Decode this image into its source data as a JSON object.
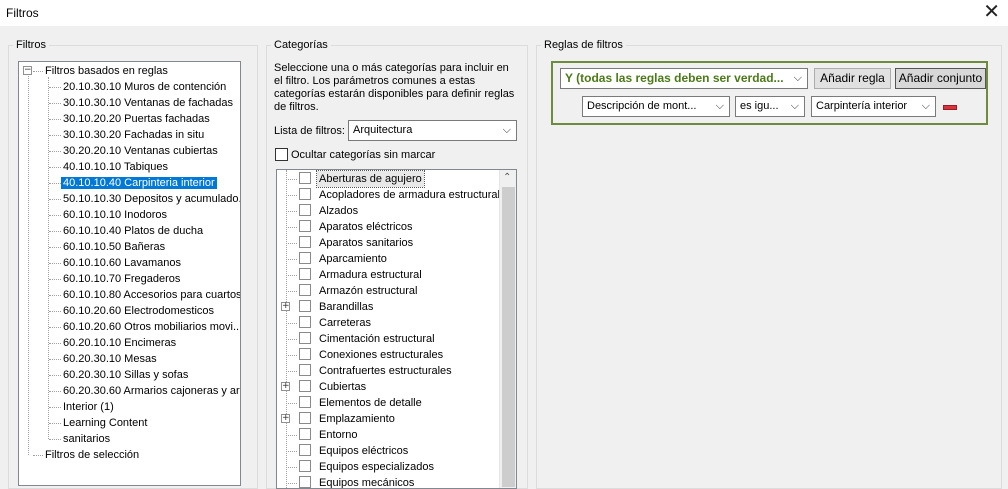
{
  "window": {
    "title": "Filtros",
    "close_glyph": "✕"
  },
  "filters_panel": {
    "legend": "Filtros",
    "root_label": "Filtros basados en reglas",
    "selected_item": "40.10.10.40 Carpinteria interior",
    "items": [
      "20.10.30.10 Muros de contención",
      "30.10.30.10 Ventanas de fachadas",
      "30.10.20.20 Puertas fachadas",
      "30.10.30.20 Fachadas in situ",
      "30.20.20.10 Ventanas cubiertas",
      "40.10.10.10 Tabiques",
      "40.10.10.40 Carpinteria interior",
      "50.10.10.30 Depositos y acumulado...",
      "60.10.10.10 Inodoros",
      "60.10.10.40 Platos de ducha",
      "60.10.10.50 Bañeras",
      "60.10.10.60 Lavamanos",
      "60.10.10.70 Fregaderos",
      "60.10.10.80 Accesorios para cuartos",
      "60.10.20.60 Electrodomesticos",
      "60.10.20.60 Otros mobiliarios movi...",
      "60.20.10.10 Encimeras",
      "60.20.30.10 Mesas",
      "60.20.30.10 Sillas y sofas",
      "60.20.30.60 Armarios cajoneras y arc",
      "Interior (1)",
      "Learning Content",
      "sanitarios"
    ],
    "selection_root_label": "Filtros de selección"
  },
  "categories_panel": {
    "legend": "Categorías",
    "description": "Seleccione una o más categorías para incluir en el filtro. Los parámetros comunes a estas categorías estarán disponibles para definir reglas de filtros.",
    "filter_list_label": "Lista de filtros:",
    "filter_list_value": "Arquitectura",
    "hide_unchecked_label": "Ocultar categorías sin marcar",
    "items": [
      {
        "label": "Aberturas de agujero",
        "expandable": false
      },
      {
        "label": "Acopladores de armadura estructural",
        "expandable": false
      },
      {
        "label": "Alzados",
        "expandable": false
      },
      {
        "label": "Aparatos eléctricos",
        "expandable": false
      },
      {
        "label": "Aparatos sanitarios",
        "expandable": false
      },
      {
        "label": "Aparcamiento",
        "expandable": false
      },
      {
        "label": "Armadura estructural",
        "expandable": false
      },
      {
        "label": "Armazón estructural",
        "expandable": false
      },
      {
        "label": "Barandillas",
        "expandable": true
      },
      {
        "label": "Carreteras",
        "expandable": false
      },
      {
        "label": "Cimentación estructural",
        "expandable": false
      },
      {
        "label": "Conexiones estructurales",
        "expandable": false
      },
      {
        "label": "Contrafuertes estructurales",
        "expandable": false
      },
      {
        "label": "Cubiertas",
        "expandable": true
      },
      {
        "label": "Elementos de detalle",
        "expandable": false
      },
      {
        "label": "Emplazamiento",
        "expandable": true
      },
      {
        "label": "Entorno",
        "expandable": false
      },
      {
        "label": "Equipos eléctricos",
        "expandable": false
      },
      {
        "label": "Equipos especializados",
        "expandable": false
      },
      {
        "label": "Equipos mecánicos",
        "expandable": false
      }
    ]
  },
  "rules_panel": {
    "legend": "Reglas de filtros",
    "logic_value": "Y (todas las reglas deben ser verdad...",
    "add_rule_label": "Añadir regla",
    "add_set_label": "Añadir conjunto",
    "rule": {
      "parameter": "Descripción de mont...",
      "operator": "es igu...",
      "value": "Carpintería interior"
    }
  },
  "colors": {
    "selection": "#0078d7",
    "rule_border": "#6d8c3e",
    "rule_text": "#4c7a1a",
    "remove": "#d9343b"
  }
}
